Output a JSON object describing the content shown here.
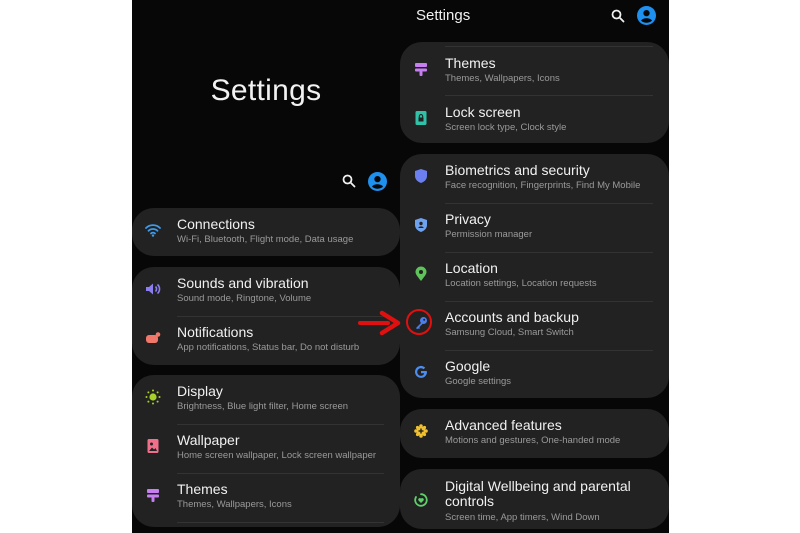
{
  "left_screen": {
    "title": "Settings",
    "header_icons": [
      "search-icon",
      "profile-icon"
    ],
    "groups": [
      {
        "items": [
          {
            "title": "Connections",
            "subtitle": "Wi-Fi, Bluetooth, Flight mode, Data usage",
            "icon": "wifi-icon",
            "color": "#3d9be9"
          }
        ]
      },
      {
        "items": [
          {
            "title": "Sounds and vibration",
            "subtitle": "Sound mode, Ringtone, Volume",
            "icon": "volume-icon",
            "color": "#8b7ef0"
          },
          {
            "title": "Notifications",
            "subtitle": "App notifications, Status bar, Do not disturb",
            "icon": "notification-icon",
            "color": "#f0786a"
          }
        ]
      },
      {
        "items": [
          {
            "title": "Display",
            "subtitle": "Brightness, Blue light filter, Home screen",
            "icon": "brightness-icon",
            "color": "#a6d12a"
          },
          {
            "title": "Wallpaper",
            "subtitle": "Home screen wallpaper, Lock screen wallpaper",
            "icon": "wallpaper-icon",
            "color": "#f0708c"
          },
          {
            "title": "Themes",
            "subtitle": "Themes, Wallpapers, Icons",
            "icon": "themes-icon",
            "color": "#c77ef0"
          }
        ]
      }
    ]
  },
  "right_screen": {
    "title": "Settings",
    "header_icons": [
      "search-icon",
      "profile-icon"
    ],
    "groups": [
      {
        "items": [
          {
            "title": "Themes",
            "subtitle": "Themes, Wallpapers, Icons",
            "icon": "themes-icon",
            "color": "#c77ef0"
          },
          {
            "title": "Lock screen",
            "subtitle": "Screen lock type, Clock style",
            "icon": "lock-screen-icon",
            "color": "#2fc2a8"
          }
        ]
      },
      {
        "items": [
          {
            "title": "Biometrics and security",
            "subtitle": "Face recognition, Fingerprints, Find My Mobile",
            "icon": "shield-icon",
            "color": "#6c7ff0"
          },
          {
            "title": "Privacy",
            "subtitle": "Permission manager",
            "icon": "privacy-shield-icon",
            "color": "#6ea2ef"
          },
          {
            "title": "Location",
            "subtitle": "Location settings, Location requests",
            "icon": "location-pin-icon",
            "color": "#5fc25a"
          },
          {
            "title": "Accounts and backup",
            "subtitle": "Samsung Cloud, Smart Switch",
            "icon": "key-icon",
            "color": "#4b7ef0",
            "highlighted": true
          },
          {
            "title": "Google",
            "subtitle": "Google settings",
            "icon": "google-icon",
            "color": "#4b8ef0"
          }
        ]
      },
      {
        "items": [
          {
            "title": "Advanced features",
            "subtitle": "Motions and gestures, One-handed mode",
            "icon": "advanced-gear-icon",
            "color": "#f0c030"
          }
        ]
      },
      {
        "items": [
          {
            "title": "Digital Wellbeing and parental controls",
            "subtitle": "Screen time, App timers, Wind Down",
            "icon": "wellbeing-icon",
            "color": "#5fd06a"
          }
        ]
      }
    ]
  },
  "annotation": {
    "arrow_color": "#e01010",
    "target": "Accounts and backup"
  },
  "colors": {
    "background": "#070707",
    "card": "#222222",
    "accent_profile": "#1e90f0"
  }
}
